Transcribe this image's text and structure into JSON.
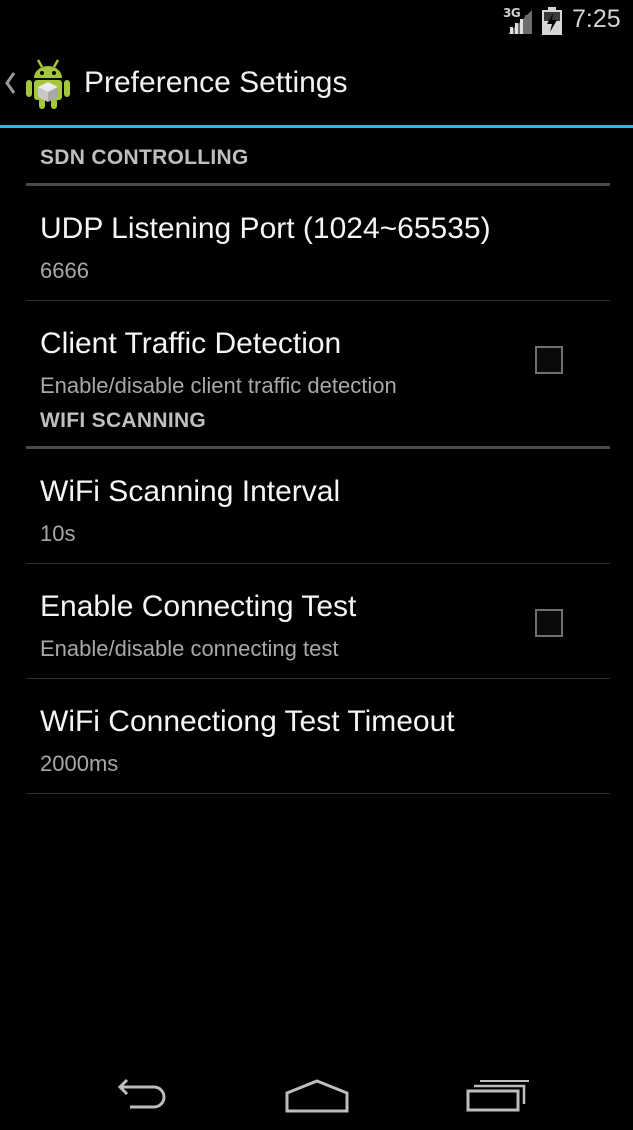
{
  "status_bar": {
    "network_type": "3G",
    "time": "7:25",
    "icons": [
      "signal-icon",
      "battery-icon"
    ]
  },
  "action_bar": {
    "title": "Preference Settings",
    "icons": [
      "up-caret-icon",
      "android-app-icon"
    ]
  },
  "preferences": {
    "sdn": {
      "category_label": "SDN CONTROLLING",
      "udp_port": {
        "title": "UDP Listening Port (1024~65535)",
        "summary": "6666"
      },
      "client_traffic": {
        "title": "Client Traffic Detection",
        "summary": "Enable/disable client traffic detection",
        "checked": false
      }
    },
    "wifi": {
      "category_label": "WIFI SCANNING",
      "scan_interval": {
        "title": "WiFi Scanning Interval",
        "summary": "10s"
      },
      "connecting_test": {
        "title": "Enable Connecting Test",
        "summary": "Enable/disable connecting test",
        "checked": false
      },
      "test_timeout": {
        "title": "WiFi Connectiong Test Timeout",
        "summary": "2000ms"
      }
    }
  },
  "colors": {
    "accent": "#33b5e5",
    "background": "#000000",
    "summary_text": "#a8a8a8",
    "category_text": "#bfbfbf"
  },
  "nav_bar": {
    "icons": [
      "back-icon",
      "home-icon",
      "recents-icon"
    ]
  }
}
